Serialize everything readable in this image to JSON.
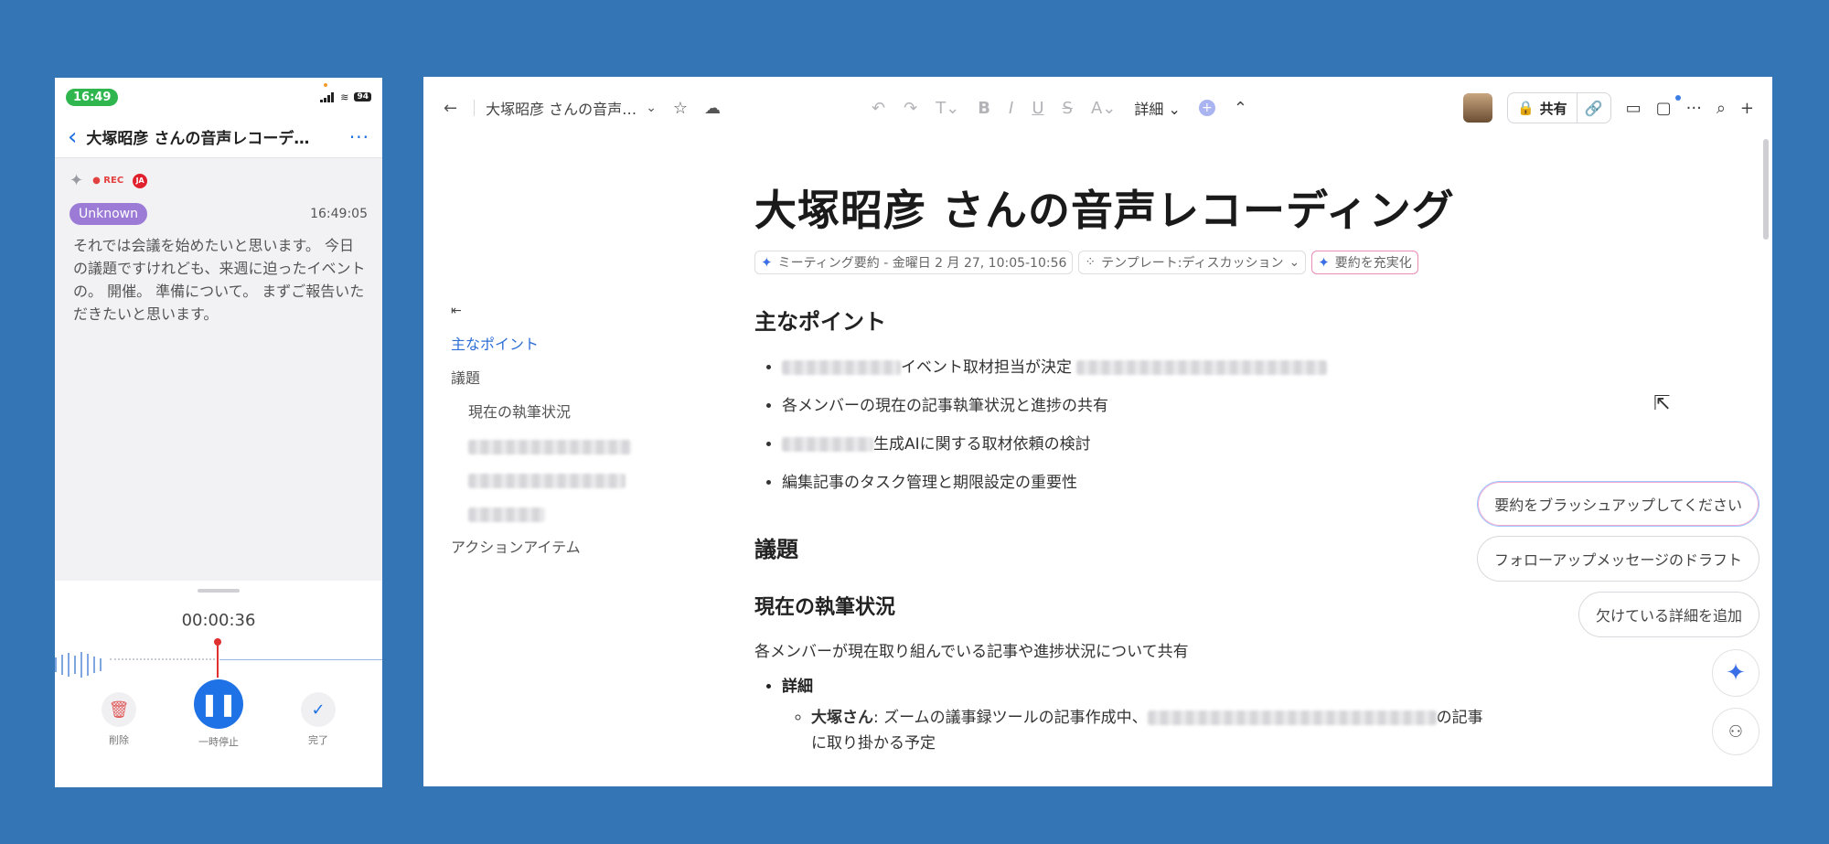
{
  "phone": {
    "status": {
      "time": "16:49",
      "battery": "94"
    },
    "header": {
      "back": "‹",
      "title": "大塚昭彦 さんの音声レコーデ…",
      "more": "···"
    },
    "tags": {
      "rec": "● REC",
      "lang": "JA"
    },
    "speaker": {
      "name": "Unknown",
      "time": "16:49:05"
    },
    "transcript": "それでは会議を始めたいと思います。 今日の議題ですけれども、来週に迫ったイベントの。 開催。 準備について。 まずご報告いただきたいと思います。",
    "recorder": {
      "elapsed": "00:00:36",
      "delete_label": "削除",
      "pause_label": "一時停止",
      "done_label": "完了"
    }
  },
  "window": {
    "toolbar": {
      "doc_title": "大塚昭彦 さんの音声…",
      "detail_label": "詳細",
      "share_label": "共有"
    },
    "outline": {
      "collapse": "⇤",
      "items": [
        "主なポイント",
        "議題",
        "現在の執筆状況",
        "アクションアイテム"
      ]
    },
    "doc": {
      "title": "大塚昭彦 さんの音声レコーディング",
      "chip_meeting": "ミーティング要約 - 金曜日 2 月 27, 10:05-10:56",
      "chip_template": "テンプレート:ディスカッション",
      "chip_enrich": "要約を充実化",
      "h_points": "主なポイント",
      "points": [
        "イベント取材担当が決定",
        "各メンバーの現在の記事執筆状況と進捗の共有",
        "生成AIに関する取材依頼の検討",
        "編集記事のタスク管理と期限設定の重要性"
      ],
      "h_agenda": "議題",
      "h_status": "現在の執筆状況",
      "status_para": "各メンバーが現在取り組んでいる記事や進捗状況について共有",
      "detail_head": "詳細",
      "detail_name": "大塚さん",
      "detail_text1": ": ズームの議事録ツールの記事作成中、",
      "detail_text2": "の記事",
      "detail_text3": "に取り掛かる予定"
    },
    "suggestions": [
      "要約をブラッシュアップしてください",
      "フォローアップメッセージのドラフト",
      "欠けている詳細を追加"
    ]
  }
}
